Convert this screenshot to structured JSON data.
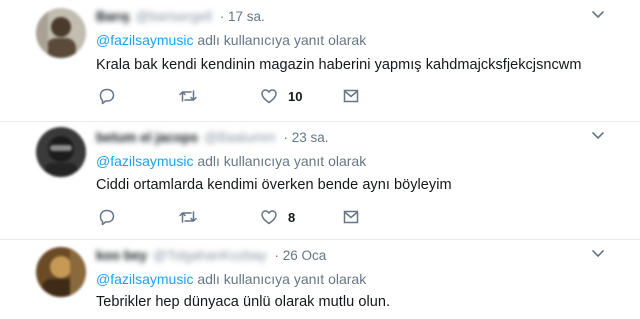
{
  "tweets": [
    {
      "name": "Barış",
      "handle": "@barisergell",
      "time": "· 17 sa.",
      "reply_mention": "@fazilsaymusic",
      "reply_suffix": " adlı kullanıcıya yanıt olarak",
      "text": "Krala bak kendi kendinin magazin haberini yapmış kahdmajcksfjekcjsncwm",
      "likes": "10",
      "avatar_colors": [
        "#5a4a3a",
        "#b9b2a4"
      ]
    },
    {
      "name": "betum el jacops",
      "handle": "@Baatumm",
      "time": "· 23 sa.",
      "reply_mention": "@fazilsaymusic",
      "reply_suffix": " adlı kullanıcıya yanıt olarak",
      "text": "Ciddi ortamlarda kendimi överken bende aynı böyleyim",
      "likes": "8",
      "avatar_colors": [
        "#1e1e1e",
        "#6e6e6e"
      ]
    },
    {
      "name": "koo bey",
      "handle": "@TolgahanKozbay",
      "time": "· 26 Oca",
      "reply_mention": "@fazilsaymusic",
      "reply_suffix": " adlı kullanıcıya yanıt olarak",
      "text": "Tebrikler hep dünyaca ünlü olarak mutlu olun.",
      "likes": "",
      "avatar_colors": [
        "#4a3520",
        "#c69a55"
      ]
    }
  ],
  "icons": {
    "reply": "reply-icon",
    "retweet": "retweet-icon",
    "like": "heart-icon",
    "dm": "envelope-icon",
    "menu": "chevron-down-icon"
  },
  "colors": {
    "mention": "#1da1f2",
    "muted": "#657786",
    "text": "#14171a",
    "divider": "#e6ecf0"
  }
}
